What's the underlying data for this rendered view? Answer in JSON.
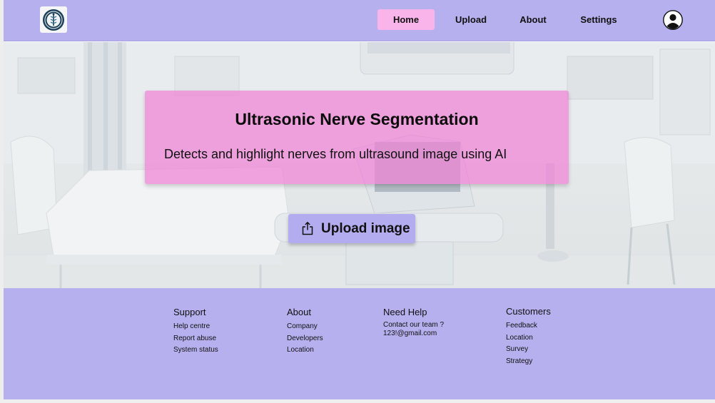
{
  "nav": {
    "logo_icon": "medical-emblem-icon",
    "items": [
      {
        "label": "Home",
        "active": true
      },
      {
        "label": "Upload",
        "active": false
      },
      {
        "label": "About",
        "active": false
      },
      {
        "label": "Settings",
        "active": false
      }
    ],
    "avatar_icon": "user-avatar-icon"
  },
  "hero": {
    "title": "Ultrasonic Nerve Segmentation",
    "subtitle": "Detects and highlight nerves from ultrasound image using AI",
    "upload_label": "Upload image",
    "upload_icon": "share-upload-icon",
    "background": "hospital-ultrasound-room-photo"
  },
  "footer": {
    "support": {
      "heading": "Support",
      "links": [
        "Help centre",
        "Report abuse",
        "System status"
      ]
    },
    "about": {
      "heading": "About",
      "links": [
        "Company",
        "Developers",
        "Location"
      ]
    },
    "help": {
      "heading": "Need Help",
      "lines": [
        "Contact our team ?",
        "123!@gmail.com"
      ]
    },
    "customers": {
      "heading": "Customers",
      "links": [
        "Feedback",
        "Location",
        "Survey",
        "Strategy"
      ]
    }
  },
  "colors": {
    "nav_bg": "#b6b0ee",
    "home_active": "#f9b4ea",
    "hero_card": "#f082d6",
    "upload_btn": "#b3adf0",
    "footer_bg": "#b6b0ee"
  }
}
